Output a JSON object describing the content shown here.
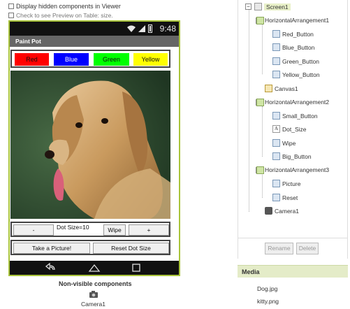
{
  "viewer": {
    "display_hidden_label": "Display hidden components in Viewer",
    "preview_label": "Check to see Preview on Table: size.",
    "status_time": "9:48",
    "app_title": "Paint Pot",
    "color_buttons": [
      "Red",
      "Blue",
      "Green",
      "Yellow"
    ],
    "small_button": "-",
    "dot_size": "Dot Size=10",
    "wipe_button": "Wipe",
    "big_button": "+",
    "take_picture_button": "Take a Picture!",
    "reset_dot_button": "Reset Dot Size",
    "nonvisible_label": "Non-visible components",
    "camera_label": "Camera1"
  },
  "tree": {
    "screen": "Screen1",
    "harr1": "HorizontalArrangement1",
    "red": "Red_Button",
    "blue": "Blue_Button",
    "green": "Green_Button",
    "yellow": "Yellow_Button",
    "canvas": "Canvas1",
    "harr2": "HorizontalArrangement2",
    "small": "Small_Button",
    "dot": "Dot_Size",
    "wipe": "Wipe",
    "big": "Big_Button",
    "harr3": "HorizontalArrangement3",
    "picture": "Picture",
    "reset": "Reset",
    "camera": "Camera1",
    "rename_button": "Rename",
    "delete_button": "Delete"
  },
  "media": {
    "title": "Media",
    "items": [
      "Dog.jpg",
      "kitty.png"
    ]
  },
  "colors": {
    "accent_green": "#a8c33a",
    "red": "#ff0000",
    "blue": "#0000ff",
    "green": "#00ff00",
    "yellow": "#ffff00"
  }
}
